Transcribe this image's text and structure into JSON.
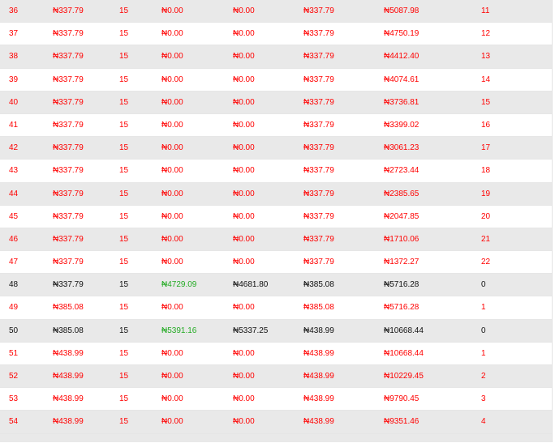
{
  "colors": {
    "red": "#ff0000",
    "black": "#111111",
    "green": "#22aa22",
    "row_even": "#e9e9e9",
    "row_odd": "#ffffff"
  },
  "rows": [
    {
      "style": "red",
      "cells": [
        "36",
        "₦337.79",
        "15",
        "₦0.00",
        "₦0.00",
        "₦337.79",
        "₦5087.98",
        "11"
      ]
    },
    {
      "style": "red",
      "cells": [
        "37",
        "₦337.79",
        "15",
        "₦0.00",
        "₦0.00",
        "₦337.79",
        "₦4750.19",
        "12"
      ]
    },
    {
      "style": "red",
      "cells": [
        "38",
        "₦337.79",
        "15",
        "₦0.00",
        "₦0.00",
        "₦337.79",
        "₦4412.40",
        "13"
      ]
    },
    {
      "style": "red",
      "cells": [
        "39",
        "₦337.79",
        "15",
        "₦0.00",
        "₦0.00",
        "₦337.79",
        "₦4074.61",
        "14"
      ]
    },
    {
      "style": "red",
      "cells": [
        "40",
        "₦337.79",
        "15",
        "₦0.00",
        "₦0.00",
        "₦337.79",
        "₦3736.81",
        "15"
      ]
    },
    {
      "style": "red",
      "cells": [
        "41",
        "₦337.79",
        "15",
        "₦0.00",
        "₦0.00",
        "₦337.79",
        "₦3399.02",
        "16"
      ]
    },
    {
      "style": "red",
      "cells": [
        "42",
        "₦337.79",
        "15",
        "₦0.00",
        "₦0.00",
        "₦337.79",
        "₦3061.23",
        "17"
      ]
    },
    {
      "style": "red",
      "cells": [
        "43",
        "₦337.79",
        "15",
        "₦0.00",
        "₦0.00",
        "₦337.79",
        "₦2723.44",
        "18"
      ]
    },
    {
      "style": "red",
      "cells": [
        "44",
        "₦337.79",
        "15",
        "₦0.00",
        "₦0.00",
        "₦337.79",
        "₦2385.65",
        "19"
      ]
    },
    {
      "style": "red",
      "cells": [
        "45",
        "₦337.79",
        "15",
        "₦0.00",
        "₦0.00",
        "₦337.79",
        "₦2047.85",
        "20"
      ]
    },
    {
      "style": "red",
      "cells": [
        "46",
        "₦337.79",
        "15",
        "₦0.00",
        "₦0.00",
        "₦337.79",
        "₦1710.06",
        "21"
      ]
    },
    {
      "style": "red",
      "cells": [
        "47",
        "₦337.79",
        "15",
        "₦0.00",
        "₦0.00",
        "₦337.79",
        "₦1372.27",
        "22"
      ]
    },
    {
      "style": "black",
      "cells": [
        "48",
        "₦337.79",
        "15",
        "₦4729.09",
        "₦4681.80",
        "₦385.08",
        "₦5716.28",
        "0"
      ]
    },
    {
      "style": "red",
      "cells": [
        "49",
        "₦385.08",
        "15",
        "₦0.00",
        "₦0.00",
        "₦385.08",
        "₦5716.28",
        "1"
      ]
    },
    {
      "style": "black",
      "cells": [
        "50",
        "₦385.08",
        "15",
        "₦5391.16",
        "₦5337.25",
        "₦438.99",
        "₦10668.44",
        "0"
      ]
    },
    {
      "style": "red",
      "cells": [
        "51",
        "₦438.99",
        "15",
        "₦0.00",
        "₦0.00",
        "₦438.99",
        "₦10668.44",
        "1"
      ]
    },
    {
      "style": "red",
      "cells": [
        "52",
        "₦438.99",
        "15",
        "₦0.00",
        "₦0.00",
        "₦438.99",
        "₦10229.45",
        "2"
      ]
    },
    {
      "style": "red",
      "cells": [
        "53",
        "₦438.99",
        "15",
        "₦0.00",
        "₦0.00",
        "₦438.99",
        "₦9790.45",
        "3"
      ]
    },
    {
      "style": "red",
      "cells": [
        "54",
        "₦438.99",
        "15",
        "₦0.00",
        "₦0.00",
        "₦438.99",
        "₦9351.46",
        "4"
      ]
    }
  ]
}
